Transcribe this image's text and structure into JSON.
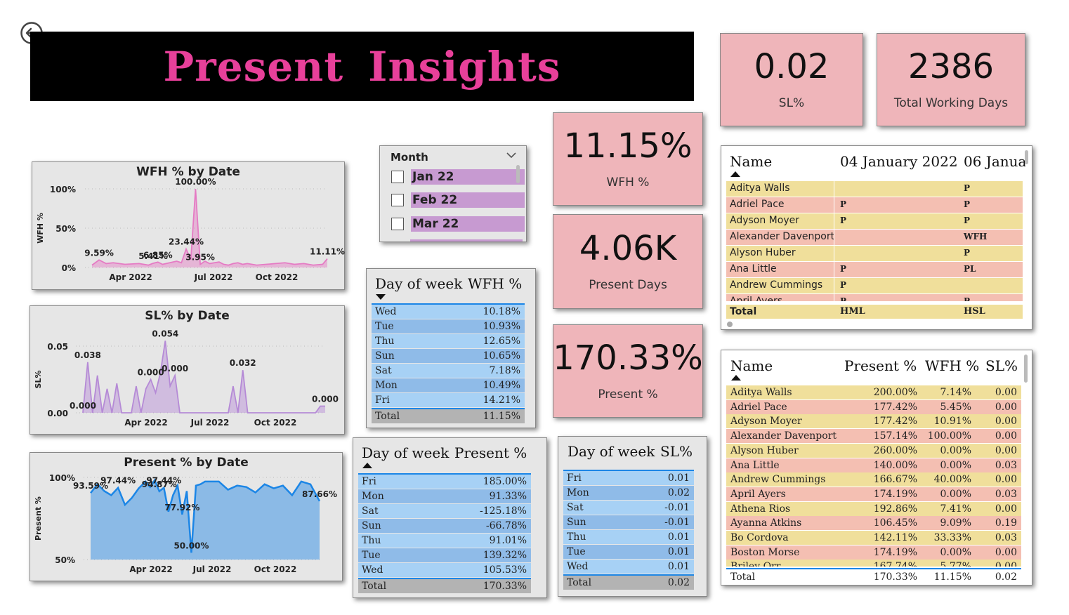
{
  "header": {
    "title": "Present Insights"
  },
  "cards": {
    "sl": {
      "value": "0.02",
      "label": "SL%"
    },
    "twd": {
      "value": "2386",
      "label": "Total Working Days"
    },
    "wfh": {
      "value": "11.15%",
      "label": "WFH %"
    },
    "pdays": {
      "value": "4.06K",
      "label": "Present Days"
    },
    "ppct": {
      "value": "170.33%",
      "label": "Present %"
    }
  },
  "slicer": {
    "title": "Month",
    "items": [
      "Jan 22",
      "Feb 22",
      "Mar 22"
    ]
  },
  "dow_wfh": {
    "headers": [
      "Day of week",
      "WFH %"
    ],
    "rows": [
      [
        "Wed",
        "10.18%"
      ],
      [
        "Tue",
        "10.93%"
      ],
      [
        "Thu",
        "12.65%"
      ],
      [
        "Sun",
        "10.65%"
      ],
      [
        "Sat",
        "7.18%"
      ],
      [
        "Mon",
        "10.49%"
      ],
      [
        "Fri",
        "14.21%"
      ]
    ],
    "total": [
      "Total",
      "11.15%"
    ]
  },
  "dow_present": {
    "headers": [
      "Day of week",
      "Present %"
    ],
    "rows": [
      [
        "Fri",
        "185.00%"
      ],
      [
        "Mon",
        "91.33%"
      ],
      [
        "Sat",
        "-125.18%"
      ],
      [
        "Sun",
        "-66.78%"
      ],
      [
        "Thu",
        "91.01%"
      ],
      [
        "Tue",
        "139.32%"
      ],
      [
        "Wed",
        "105.53%"
      ]
    ],
    "total": [
      "Total",
      "170.33%"
    ]
  },
  "dow_sl": {
    "headers": [
      "Day of week",
      "SL%"
    ],
    "rows": [
      [
        "Fri",
        "0.01"
      ],
      [
        "Mon",
        "0.02"
      ],
      [
        "Sat",
        "-0.01"
      ],
      [
        "Sun",
        "-0.01"
      ],
      [
        "Thu",
        "0.01"
      ],
      [
        "Tue",
        "0.01"
      ],
      [
        "Wed",
        "0.01"
      ]
    ],
    "total": [
      "Total",
      "0.02"
    ]
  },
  "matrix": {
    "headers": [
      "Name",
      "04 January 2022",
      "06 Janua"
    ],
    "rows": [
      [
        "Aditya Walls",
        "",
        "P"
      ],
      [
        "Adriel Pace",
        "P",
        "P"
      ],
      [
        "Adyson Moyer",
        "P",
        "P"
      ],
      [
        "Alexander Davenport",
        "",
        "WFH"
      ],
      [
        "Alyson Huber",
        "",
        "P"
      ],
      [
        "Ana Little",
        "P",
        "PL"
      ],
      [
        "Andrew Cummings",
        "P",
        ""
      ],
      [
        "April Ayers",
        "P",
        "P"
      ]
    ],
    "total": [
      "Total",
      "HML",
      "HSL"
    ]
  },
  "people": {
    "headers": [
      "Name",
      "Present %",
      "WFH %",
      "SL%"
    ],
    "rows": [
      [
        "Aditya Walls",
        "200.00%",
        "7.14%",
        "0.00"
      ],
      [
        "Adriel Pace",
        "177.42%",
        "5.45%",
        "0.00"
      ],
      [
        "Adyson Moyer",
        "177.42%",
        "10.91%",
        "0.00"
      ],
      [
        "Alexander Davenport",
        "157.14%",
        "100.00%",
        "0.00"
      ],
      [
        "Alyson Huber",
        "260.00%",
        "0.00%",
        "0.00"
      ],
      [
        "Ana Little",
        "140.00%",
        "0.00%",
        "0.03"
      ],
      [
        "Andrew Cummings",
        "166.67%",
        "40.00%",
        "0.00"
      ],
      [
        "April Ayers",
        "174.19%",
        "0.00%",
        "0.03"
      ],
      [
        "Athena Rios",
        "192.86%",
        "7.41%",
        "0.00"
      ],
      [
        "Ayanna Atkins",
        "106.45%",
        "9.09%",
        "0.19"
      ],
      [
        "Bo Cordova",
        "142.11%",
        "33.33%",
        "0.03"
      ],
      [
        "Boston Morse",
        "174.19%",
        "0.00%",
        "0.00"
      ],
      [
        "Briley Orr",
        "167.74%",
        "5.77%",
        "0.00"
      ]
    ],
    "total": [
      "Total",
      "170.33%",
      "11.15%",
      "0.02"
    ]
  },
  "chart_data": [
    {
      "type": "area",
      "title": "WFH % by Date",
      "ylabel": "WFH %",
      "x_ticks": [
        "Apr 2022",
        "Jul 2022",
        "Oct 2022"
      ],
      "y_ticks": [
        "100%",
        "50%",
        "0%"
      ],
      "ylim": [
        0,
        100
      ],
      "color": "#e57bc4",
      "x": [
        0,
        3,
        6,
        9,
        14,
        20,
        24,
        26,
        28,
        30,
        33,
        36,
        38,
        40,
        42,
        44,
        46,
        48,
        50,
        52,
        54,
        56,
        58,
        60,
        62,
        64,
        66,
        68,
        70,
        74,
        78,
        82,
        86,
        90,
        94,
        98,
        100
      ],
      "values": [
        3,
        9.59,
        5,
        6,
        4,
        5,
        3,
        5.41,
        6.85,
        4,
        6,
        8,
        6,
        23.44,
        10,
        100,
        3.95,
        8,
        5,
        6,
        7,
        4,
        3,
        5,
        6,
        4,
        5,
        4,
        3,
        4,
        5,
        6,
        4,
        5,
        3,
        4,
        11.11
      ],
      "labels": [
        {
          "text": "9.59%",
          "xi": 1
        },
        {
          "text": "5.41%",
          "xi": 7
        },
        {
          "text": "6.85%",
          "xi": 8
        },
        {
          "text": "23.44%",
          "xi": 13
        },
        {
          "text": "100.00%",
          "xi": 15
        },
        {
          "text": "3.95%",
          "xi": 16
        },
        {
          "text": "11.11%",
          "xi": 36
        }
      ]
    },
    {
      "type": "area",
      "title": "SL% by Date",
      "ylabel": "SL%",
      "x_ticks": [
        "Apr 2022",
        "Jul 2022",
        "Oct 2022"
      ],
      "y_ticks": [
        "0.05",
        "0.00"
      ],
      "ylim": [
        0,
        0.05
      ],
      "color": "#b58ad6",
      "x": [
        0,
        2,
        4,
        6,
        8,
        10,
        12,
        14,
        16,
        18,
        20,
        22,
        24,
        26,
        28,
        30,
        32,
        34,
        36,
        38,
        40,
        44,
        48,
        52,
        56,
        60,
        62,
        64,
        66,
        68,
        70,
        72,
        74,
        76,
        78,
        80,
        82,
        84,
        86,
        88,
        90,
        92,
        94,
        96,
        98,
        100
      ],
      "values": [
        0,
        0.038,
        0,
        0.028,
        0,
        0.018,
        0,
        0.022,
        0,
        0,
        0,
        0.02,
        0,
        0.018,
        0.025,
        0.015,
        0.03,
        0.054,
        0.02,
        0.028,
        0,
        0,
        0,
        0,
        0,
        0,
        0.02,
        0,
        0.032,
        0,
        0,
        0,
        0,
        0,
        0,
        0,
        0,
        0,
        0,
        0,
        0,
        0,
        0,
        0,
        0.005,
        0.005
      ],
      "labels": [
        {
          "text": "0.038",
          "xi": 1
        },
        {
          "text": "0.000",
          "xi": 0
        },
        {
          "text": "0.000",
          "xi": 14
        },
        {
          "text": "0.054",
          "xi": 17
        },
        {
          "text": "0.000",
          "xi": 19
        },
        {
          "text": "0.032",
          "xi": 28
        },
        {
          "text": "0.000",
          "xi": 45
        }
      ]
    },
    {
      "type": "area",
      "title": "Present % by Date",
      "ylabel": "Present %",
      "x_ticks": [
        "Apr 2022",
        "Jul 2022",
        "Oct 2022"
      ],
      "y_ticks": [
        "100%",
        "50%"
      ],
      "ylim": [
        45,
        105
      ],
      "color": "#1c86e6",
      "x": [
        0,
        3,
        6,
        9,
        12,
        15,
        18,
        21,
        24,
        26,
        28,
        30,
        32,
        34,
        36,
        38,
        40,
        42,
        44,
        46,
        48,
        50,
        52,
        56,
        60,
        64,
        68,
        72,
        76,
        80,
        84,
        88,
        92,
        96,
        100
      ],
      "values": [
        93.59,
        100,
        95,
        92,
        97.44,
        85,
        90,
        97,
        102,
        98,
        103,
        94.87,
        97.44,
        80,
        92,
        99,
        77.92,
        95,
        50,
        99,
        100,
        102,
        102,
        102,
        96,
        99,
        98,
        94,
        100,
        97,
        99,
        92,
        102,
        100,
        87.66
      ],
      "labels": [
        {
          "text": "93.59%",
          "xi": 0
        },
        {
          "text": "97.44%",
          "xi": 4
        },
        {
          "text": "94.87%",
          "xi": 11
        },
        {
          "text": "97.44%",
          "xi": 12
        },
        {
          "text": "77.92%",
          "xi": 16
        },
        {
          "text": "50.00%",
          "xi": 18
        },
        {
          "text": "87.66%",
          "xi": 34
        }
      ]
    }
  ]
}
